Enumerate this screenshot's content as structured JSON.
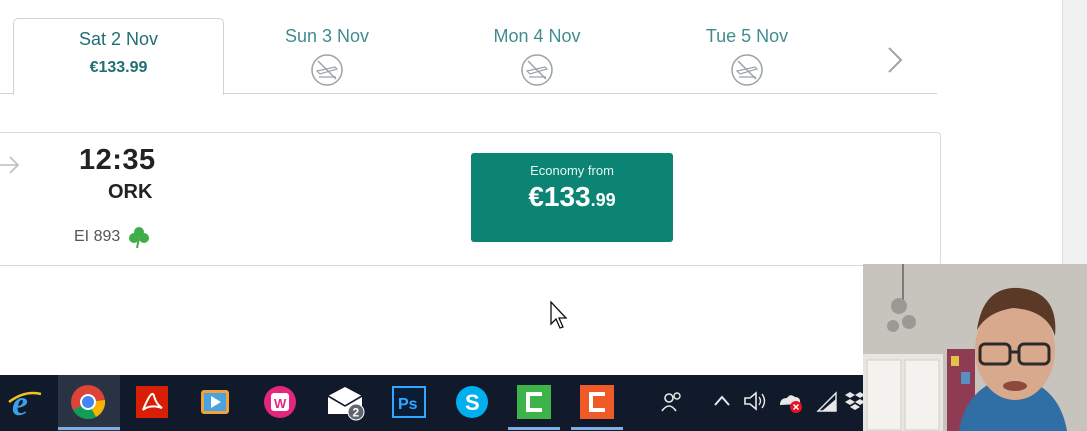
{
  "date_tabs": [
    {
      "date": "Sat 2 Nov",
      "price": "€133.99",
      "selected": true
    },
    {
      "date": "Sun 3 Nov",
      "no_flights_icon": "no-flights-icon"
    },
    {
      "date": "Mon 4 Nov",
      "no_flights_icon": "no-flights-icon"
    },
    {
      "date": "Tue 5 Nov",
      "no_flights_icon": "no-flights-icon"
    }
  ],
  "flight": {
    "arrival_time": "12:35",
    "arrival_airport": "ORK",
    "flight_number": "EI 893",
    "economy": {
      "label": "Economy from",
      "price_main": "€133",
      "price_cents": ".99"
    }
  },
  "taskbar": {
    "apps": [
      "internet-explorer",
      "chrome",
      "acrobat",
      "media-player",
      "wamp",
      "mail",
      "photoshop",
      "skype",
      "camtasia-green",
      "camtasia-red"
    ],
    "mail_badge": "2",
    "photoshop_label": "Ps"
  },
  "colors": {
    "accent": "#0b8474",
    "tab_text": "#1f6f74",
    "taskbar": "#101a2a"
  }
}
